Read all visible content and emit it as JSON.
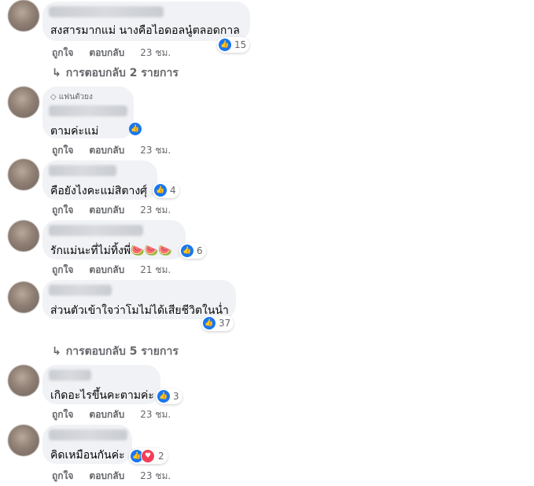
{
  "actions": {
    "like": "ถูกใจ",
    "reply": "ตอบกลับ"
  },
  "comments": [
    {
      "text": "สงสารมากแม่ นางคือไอดอลนู๋ตลอดกาล",
      "reactions": "15",
      "time": "23 ชม."
    },
    {
      "badge": "แฟนตัวยง",
      "text": "ตามค่ะแม่",
      "time": "23 ชม."
    },
    {
      "text": "คือยังไงคะแม่สิตางศุ์",
      "reactions": "4",
      "time": "23 ชม."
    },
    {
      "text": "รักแม่นะที่ไม่ทิ้งพี่🍉🍉🍉",
      "reactions": "6",
      "time": "21 ชม."
    },
    {
      "text": "ส่วนตัวเข้าใจว่าโมไม่ได้เสียชีวิตในน่ำ",
      "reactions": "37",
      "time": "23 ชม."
    },
    {
      "text": "เกิดอะไรขึ้นคะตามค่ะ",
      "reactions": "3",
      "time": "23 ชม."
    },
    {
      "text": "คิดเหมือนกันค่ะ",
      "reactions": "2",
      "time": "23 ชม."
    }
  ],
  "reply_threads": [
    {
      "label": "การตอบกลับ 2 รายการ"
    },
    {
      "label": "การตอบกลับ 5 รายการ"
    }
  ],
  "icons": {
    "like": "thumbs-up-icon",
    "love": "heart-icon",
    "reply_arrow": "reply-arrow-icon",
    "badge": "diamond-icon"
  },
  "colors": {
    "like": "#1877f2",
    "love": "#f33e58",
    "bubble": "#f0f2f5",
    "meta": "#65676b"
  }
}
